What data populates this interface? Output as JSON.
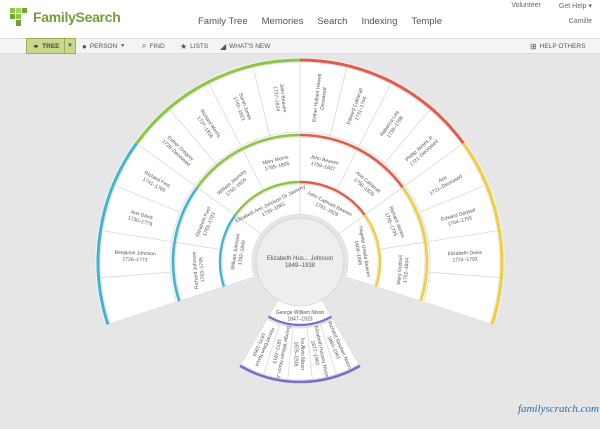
{
  "header": {
    "logo_text": "FamilySearch",
    "nav": [
      "Family Tree",
      "Memories",
      "Search",
      "Indexing",
      "Temple"
    ],
    "volunteer": "Volunteer",
    "get_help": "Get Help",
    "user": "Camille"
  },
  "toolbar": {
    "tree": "TREE",
    "person": "PERSON",
    "find": "FIND",
    "lists": "LISTS",
    "whats_new": "WHAT'S NEW",
    "help_others": "HELP OTHERS"
  },
  "colors": {
    "green": "#8dc63f",
    "red": "#e35b4b",
    "yellow": "#f0cf3c",
    "blue": "#3fb4d6",
    "purple": "#7d6cc9",
    "logo_green": "#7a9a3a"
  },
  "center": {
    "name": "Elizabeth Hus... Johnson",
    "years": "1849–1938"
  },
  "ring1": [
    {
      "name": "William Johnson",
      "years": "1782–1849"
    },
    {
      "name": "Elizabeth Ann Johnson Or Jauncey",
      "years": "1793–1883"
    },
    {
      "name": "John Cathcart Beaven",
      "years": "1791–1829"
    },
    {
      "name": "Hugette Ursula Beaven",
      "years": "1809–1896"
    }
  ],
  "ring2": [
    {
      "name": "Elizabeth Feet",
      "years": "1763–1793"
    },
    {
      "name": "William Jauncey",
      "years": "1750–1816"
    },
    {
      "name": "Mary Morris",
      "years": "1765–1805"
    },
    {
      "name": "John Beaven",
      "years": "1759–1837"
    },
    {
      "name": "Ann Catherall",
      "years": "1758–1828"
    },
    {
      "name": "Richard James",
      "years": "1765–1795"
    },
    {
      "name": "Mary Godsell",
      "years": "1752–1804"
    }
  ],
  "ring3": [
    {
      "name": "Benjamin Johnson",
      "years": "1726–1773"
    },
    {
      "name": "Ann Davis",
      "years": "1730–1779"
    },
    {
      "name": "Richard Feet",
      "years": "1741–1765"
    },
    {
      "name": "Esther Gregory",
      "years": "1728–Deceased"
    },
    {
      "name": "Richard Morris",
      "years": "1737–1816"
    },
    {
      "name": "Sarah Jones",
      "years": "1743–1823"
    },
    {
      "name": "John Beaven",
      "years": "1737–1824"
    },
    {
      "name": "Esther Hulbert Hewett",
      "years": "Deceased"
    },
    {
      "name": "Edward Catherall",
      "years": "1731–1794"
    },
    {
      "name": "Rebecca Lea",
      "years": "1736–1788"
    },
    {
      "name": "Phillip James Jr.",
      "years": "1721–Deceased"
    },
    {
      "name": "Ann",
      "years": "1721–Deceased"
    },
    {
      "name": "Edward Godsell",
      "years": "1704–1755"
    },
    {
      "name": "Elizabeth Davis",
      "years": "1724–1793"
    }
  ],
  "left_outer": {
    "name": "Richard Johnson",
    "years": "1763–1795"
  },
  "desc_parent": {
    "name": "George William Nixon",
    "years": "1847–1923"
  },
  "descendants": [
    {
      "name": "Harriet Ellen Nixon",
      "years": "1870–1958"
    },
    {
      "name": "George William Nixon Jr.",
      "years": "1872–1913"
    },
    {
      "name": "Ira Alvin Nixon",
      "years": "1875–1916"
    },
    {
      "name": "Elizabeth Hussey Nixon",
      "years": "1877–1962"
    },
    {
      "name": "Richard Stephen Nixon",
      "years": "1880–1961"
    }
  ],
  "watermark": "familyscratch.com"
}
